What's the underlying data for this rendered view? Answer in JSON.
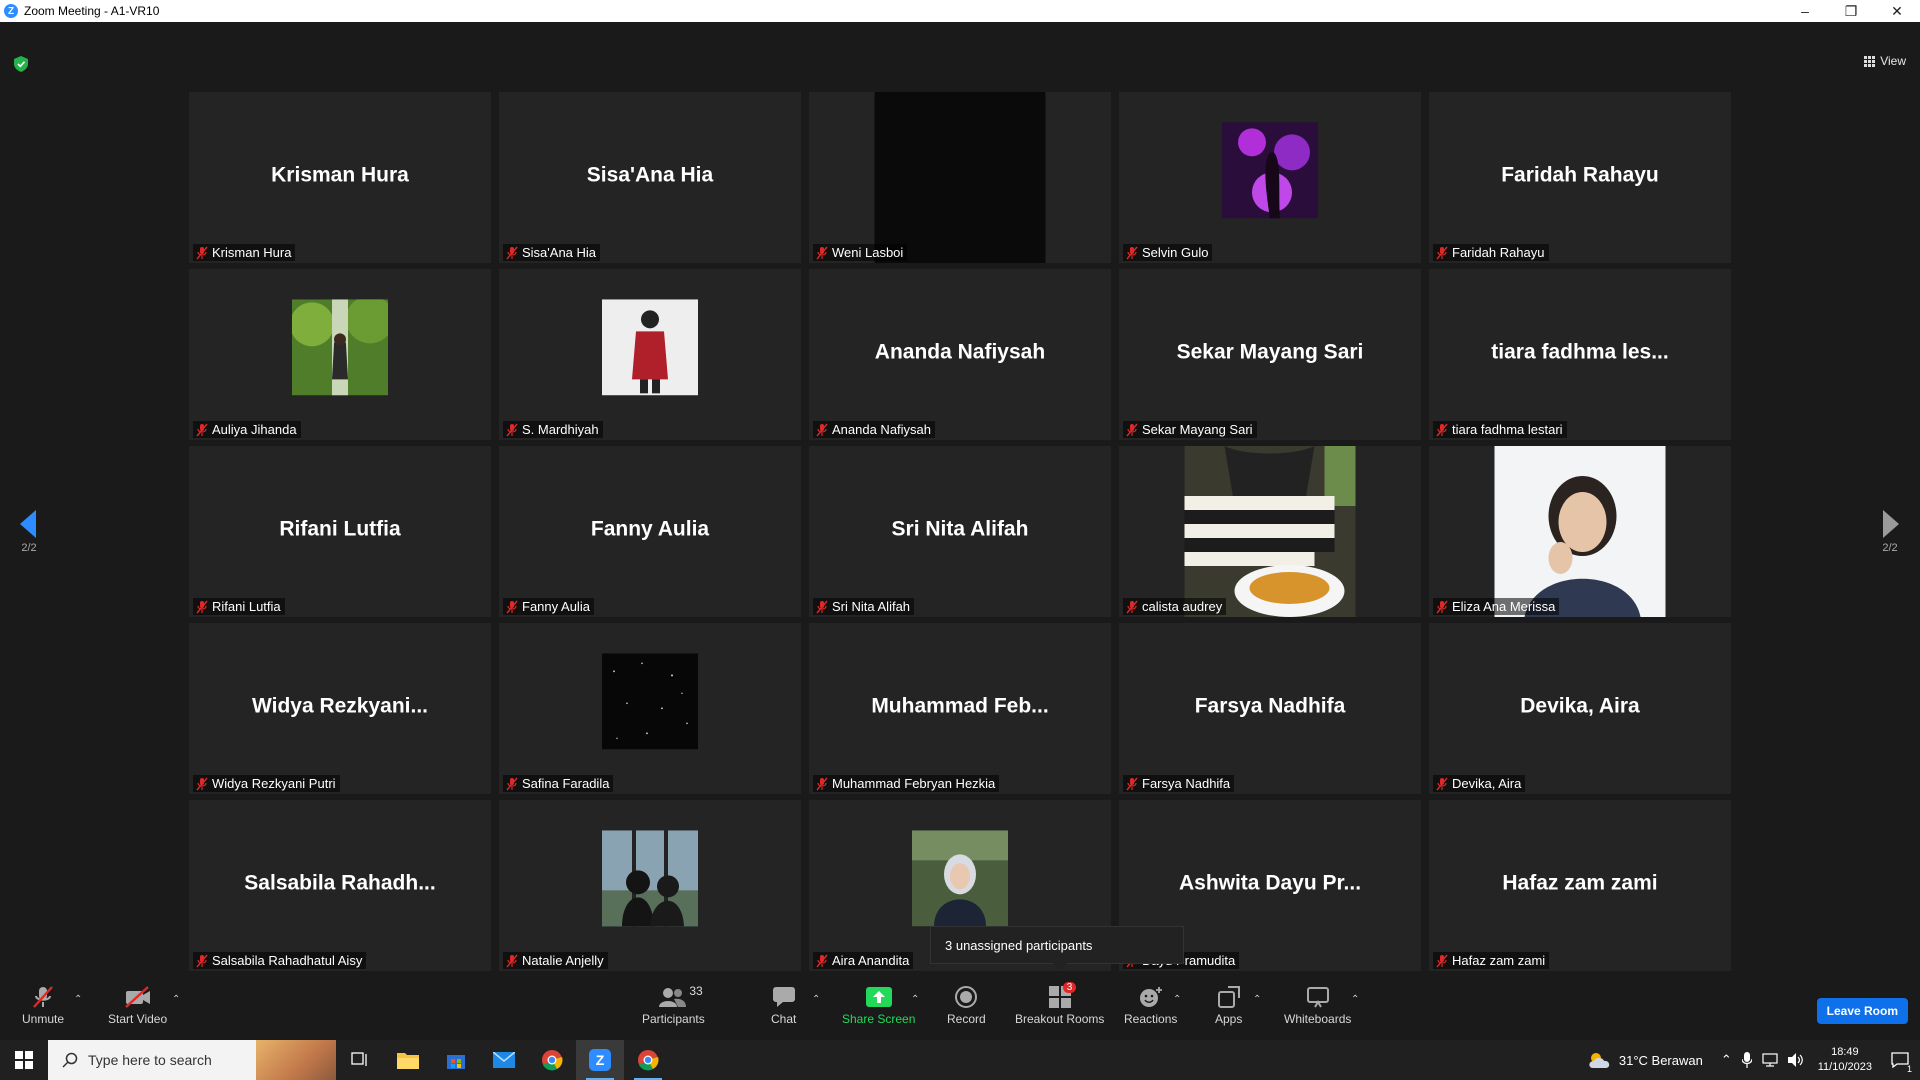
{
  "window": {
    "title": "Zoom Meeting - A1-VR10",
    "minimize": "–",
    "restore": "❐",
    "close": "✕"
  },
  "view_label": "View",
  "pagination": {
    "left": "2/2",
    "right": "2/2"
  },
  "participants": [
    {
      "display": "Krisman Hura",
      "label": "Krisman Hura",
      "kind": "name"
    },
    {
      "display": "Sisa'Ana Hia",
      "label": "Sisa'Ana Hia",
      "kind": "name"
    },
    {
      "display": "",
      "label": "Weni Lasboi",
      "kind": "black-video"
    },
    {
      "display": "",
      "label": "Selvin Gulo",
      "kind": "photo-purple"
    },
    {
      "display": "Faridah Rahayu",
      "label": "Faridah Rahayu",
      "kind": "name"
    },
    {
      "display": "",
      "label": "Auliya Jihanda",
      "kind": "photo-garden"
    },
    {
      "display": "",
      "label": "S. Mardhiyah",
      "kind": "photo-red"
    },
    {
      "display": "Ananda Nafiysah",
      "label": "Ananda Nafiysah",
      "kind": "name"
    },
    {
      "display": "Sekar Mayang Sari",
      "label": "Sekar Mayang Sari",
      "kind": "name"
    },
    {
      "display": "tiara fadhma les...",
      "label": "tiara fadhma lestari",
      "kind": "name"
    },
    {
      "display": "Rifani Lutfia",
      "label": "Rifani Lutfia",
      "kind": "name"
    },
    {
      "display": "Fanny Aulia",
      "label": "Fanny Aulia",
      "kind": "name"
    },
    {
      "display": "Sri Nita Alifah",
      "label": "Sri Nita Alifah",
      "kind": "name"
    },
    {
      "display": "",
      "label": "calista audrey",
      "kind": "video-food"
    },
    {
      "display": "",
      "label": "Eliza Ana Merissa",
      "kind": "video-girl"
    },
    {
      "display": "Widya  Rezkyani...",
      "label": "Widya Rezkyani Putri",
      "kind": "name"
    },
    {
      "display": "",
      "label": "Safina Faradila",
      "kind": "photo-stars"
    },
    {
      "display": "Muhammad  Feb...",
      "label": "Muhammad Febryan Hezkia",
      "kind": "name"
    },
    {
      "display": "Farsya Nadhifa",
      "label": "Farsya Nadhifa",
      "kind": "name"
    },
    {
      "display": "Devika, Aira",
      "label": "Devika, Aira",
      "kind": "name"
    },
    {
      "display": "Salsabila  Rahadh...",
      "label": "Salsabila Rahadhatul Aisy",
      "kind": "name"
    },
    {
      "display": "",
      "label": "Natalie Anjelly",
      "kind": "photo-window"
    },
    {
      "display": "",
      "label": "Aira Anandita",
      "kind": "photo-hijab"
    },
    {
      "display": "Ashwita Dayu Pr...",
      "label": "Dayu Pramudita",
      "kind": "name"
    },
    {
      "display": "Hafaz zam zami",
      "label": "Hafaz zam zami",
      "kind": "name"
    }
  ],
  "tooltip": "3 unassigned participants",
  "toolbar": {
    "unmute": "Unmute",
    "start_video": "Start Video",
    "participants": "Participants",
    "participants_count": "33",
    "chat": "Chat",
    "share_screen": "Share Screen",
    "record": "Record",
    "breakout_rooms": "Breakout Rooms",
    "breakout_badge": "3",
    "reactions": "Reactions",
    "apps": "Apps",
    "whiteboards": "Whiteboards",
    "leave": "Leave Room"
  },
  "taskbar": {
    "search_placeholder": "Type here to search",
    "weather": "31°C  Berawan",
    "time": "18:49",
    "date": "11/10/2023",
    "notification_count": "1"
  },
  "colors": {
    "accent": "#0e71eb",
    "share_green": "#23d959",
    "muted_red": "#e02828",
    "tile_bg": "#242424"
  }
}
